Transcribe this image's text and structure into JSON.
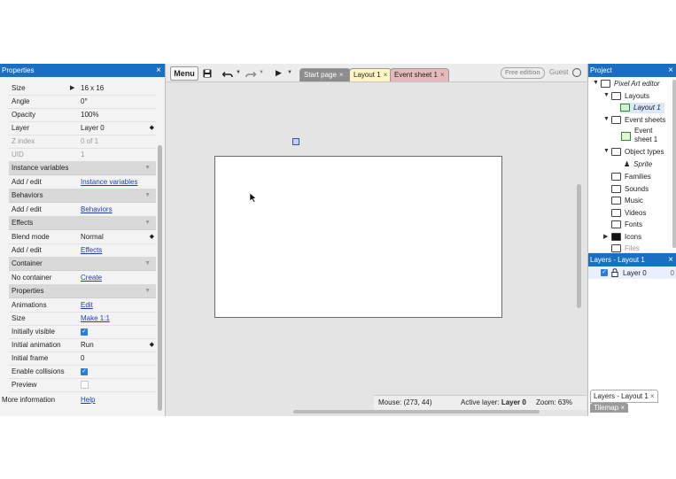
{
  "properties": {
    "title": "Properties",
    "close": "×",
    "rows": [
      {
        "k": "Size",
        "v": "16 x 16"
      },
      {
        "k": "Angle",
        "v": "0°"
      },
      {
        "k": "Opacity",
        "v": "100%"
      },
      {
        "k": "Layer",
        "v": "Layer 0"
      },
      {
        "k": "Z index",
        "v": "0 of 1"
      },
      {
        "k": "UID",
        "v": "1"
      }
    ],
    "sections": {
      "instance_vars": "Instance variables",
      "behaviors": "Behaviors",
      "effects": "Effects",
      "container": "Container",
      "properties": "Properties"
    },
    "add_edit": "Add / edit",
    "instance_vars_link": "Instance variables",
    "behaviors_link": "Behaviors",
    "blend_mode": {
      "k": "Blend mode",
      "v": "Normal"
    },
    "effects_link": "Effects",
    "no_container": "No container",
    "create_link": "Create",
    "animations": {
      "k": "Animations",
      "v": "Edit"
    },
    "size2": {
      "k": "Size",
      "v": "Make 1:1"
    },
    "initially_visible": "Initially visible",
    "initial_animation": {
      "k": "Initial animation",
      "v": "Run"
    },
    "initial_frame": {
      "k": "Initial frame",
      "v": "0"
    },
    "enable_collisions": "Enable collisions",
    "preview": "Preview",
    "more_info": {
      "k": "More information",
      "v": "Help"
    }
  },
  "toolbar": {
    "menu": "Menu",
    "tabs": [
      {
        "label": "Start page",
        "close": "×"
      },
      {
        "label": "Layout 1",
        "close": "×"
      },
      {
        "label": "Event sheet 1",
        "close": "×"
      }
    ],
    "free_edition": "Free edition",
    "guest": "Guest"
  },
  "status": {
    "mouse": "Mouse: (273, 44)",
    "active_layer_label": "Active layer:",
    "active_layer_value": "Layer 0",
    "zoom": "Zoom: 63%"
  },
  "project": {
    "title": "Project",
    "close": "×",
    "root": "Pixel Art editor",
    "layouts": "Layouts",
    "layout1": "Layout 1",
    "event_sheets": "Event sheets",
    "event_sheet1_a": "Event",
    "event_sheet1_b": "sheet 1",
    "object_types": "Object types",
    "sprite": "Sprite",
    "families": "Families",
    "sounds": "Sounds",
    "music": "Music",
    "videos": "Videos",
    "fonts": "Fonts",
    "icons": "Icons",
    "files": "Files"
  },
  "layers": {
    "title": "Layers - Layout 1",
    "close": "×",
    "row_name": "Layer 0",
    "row_value": "0",
    "bottom_tab": "Layers - Layout 1",
    "bottom_close": "×",
    "tilemap": "Tilemap",
    "tilemap_close": "×"
  }
}
